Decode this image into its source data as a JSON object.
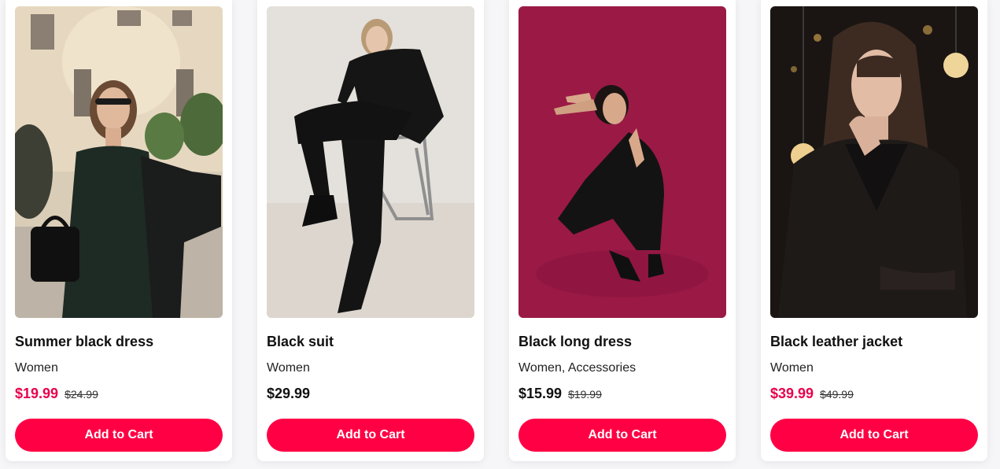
{
  "products": [
    {
      "image_alt": "Woman in black satin slip dress with sunglasses on street",
      "title": "Summer black dress",
      "category": "Women",
      "price": "$19.99",
      "old_price": "$24.99",
      "button": "Add to Cart"
    },
    {
      "image_alt": "Woman in black suit seated on a chair",
      "title": "Black suit",
      "category": "Women",
      "price": "$29.99",
      "old_price": "",
      "button": "Add to Cart"
    },
    {
      "image_alt": "Woman in black long dress crouching on magenta background",
      "title": "Black long dress",
      "category": "Women, Accessories",
      "price": "$15.99",
      "old_price": "$19.99",
      "button": "Add to Cart"
    },
    {
      "image_alt": "Woman in black leather jacket with warm lights",
      "title": "Black leather jacket",
      "category": "Women",
      "price": "$39.99",
      "old_price": "$49.99",
      "button": "Add to Cart"
    }
  ],
  "colors": {
    "accent": "#ff0044",
    "sale_price": "#e8004c",
    "card_bg": "#ffffff",
    "page_bg": "#f6f6f8"
  }
}
